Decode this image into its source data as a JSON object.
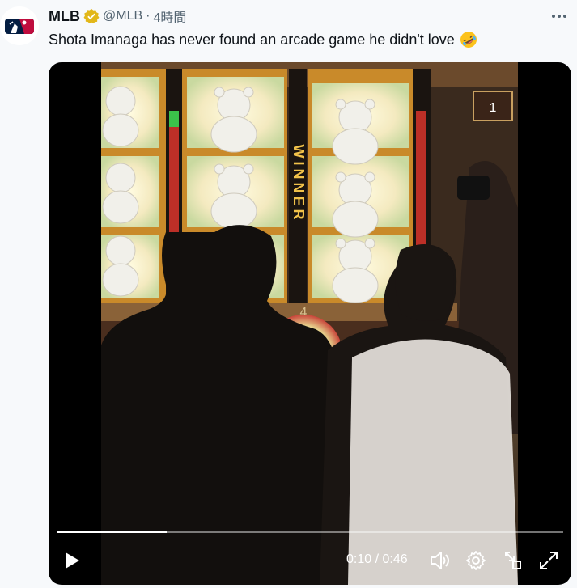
{
  "tweet": {
    "author_name": "MLB",
    "handle": "@MLB",
    "separator": "·",
    "time": "4時間",
    "text": "Shota Imanaga has never found an arcade game he didn't love",
    "emoji_icon": "rolling-on-floor-laughing-emoji"
  },
  "video": {
    "time_display": "0:10 / 0:46",
    "progress": 0.2174,
    "winner_sign": "WINNER",
    "booth_number": "1",
    "lane_number": "4"
  },
  "colors": {
    "verified_badge": "#e2b719",
    "text_primary": "#0f1419",
    "text_secondary": "#536471",
    "mlb_blue": "#041e42",
    "mlb_red": "#bf0d3e"
  }
}
